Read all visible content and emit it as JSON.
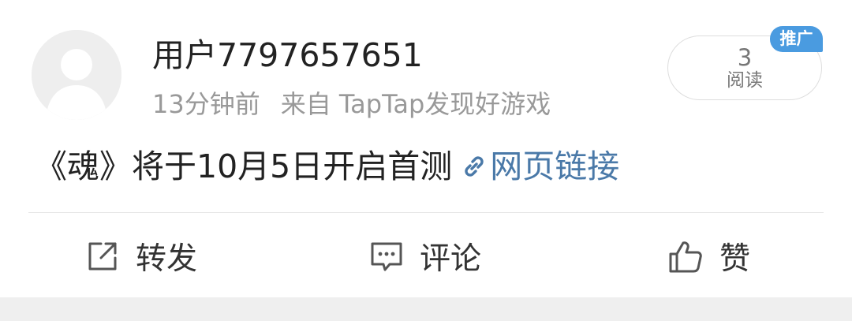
{
  "post": {
    "username": "用户7797657651",
    "time_ago": "13分钟前",
    "source": "来自 TapTap发现好游戏",
    "content": "《魂》将于10月5日开启首测",
    "link_text": "网页链接"
  },
  "reads": {
    "count": "3",
    "label": "阅读"
  },
  "badge": {
    "label": "推广"
  },
  "actions": {
    "forward": "转发",
    "comment": "评论",
    "like": "赞"
  },
  "colors": {
    "link": "#4a79a8",
    "badge": "#4a9be0",
    "meta": "#999999"
  }
}
